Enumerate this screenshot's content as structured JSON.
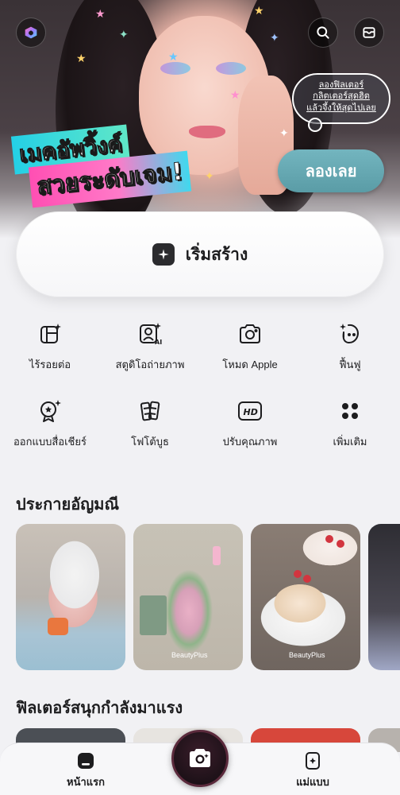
{
  "banner": {
    "title_line_1": "เมคอัพวิ้งค์",
    "title_line_2": "สวยระดับเจม!",
    "bubble_lines": [
      "ลองฟิลเตอร์",
      "กลิตเตอร์สุดฮิต",
      "แล้วจึ้งให้สุดไปเลย"
    ],
    "try_button": "ลองเลย"
  },
  "header": {
    "logo_icon": "app-logo-icon",
    "search_icon": "search-icon",
    "inbox_icon": "inbox-icon"
  },
  "create": {
    "label": "เริ่มสร้าง",
    "icon": "sparkle-icon"
  },
  "tools": [
    {
      "label": "ไร้รอยต่อ",
      "icon": "seamless-icon"
    },
    {
      "label": "สตูดิโอถ่ายภาพ",
      "icon": "ai-studio-icon"
    },
    {
      "label": "โหมด Apple",
      "icon": "camera-icon"
    },
    {
      "label": "ฟื้นฟู",
      "icon": "restore-icon"
    },
    {
      "label": "ออกแบบสื่อเชียร์",
      "icon": "cheer-design-icon"
    },
    {
      "label": "โฟโต้บูธ",
      "icon": "photobooth-icon"
    },
    {
      "label": "ปรับคุณภาพ",
      "icon": "hd-icon"
    },
    {
      "label": "เพิ่มเติม",
      "icon": "more-icon"
    }
  ],
  "sections": {
    "gems_title": "ประกายอัญมณี",
    "filters_title": "ฟิลเตอร์สนุกกำลังมาแรง"
  },
  "cards": [
    {
      "watermark": ""
    },
    {
      "watermark": "BeautyPlus"
    },
    {
      "watermark": "BeautyPlus"
    },
    {
      "watermark": ""
    }
  ],
  "nav": {
    "home": "หน้าแรก",
    "templates": "แม่แบบ",
    "camera_icon": "camera-icon"
  },
  "colors": {
    "try_button": "#5f9fa9",
    "title_pink": "#ff4fb3",
    "title_cyan": "#24d0e6",
    "camera_ring": "#5b2a3c"
  }
}
